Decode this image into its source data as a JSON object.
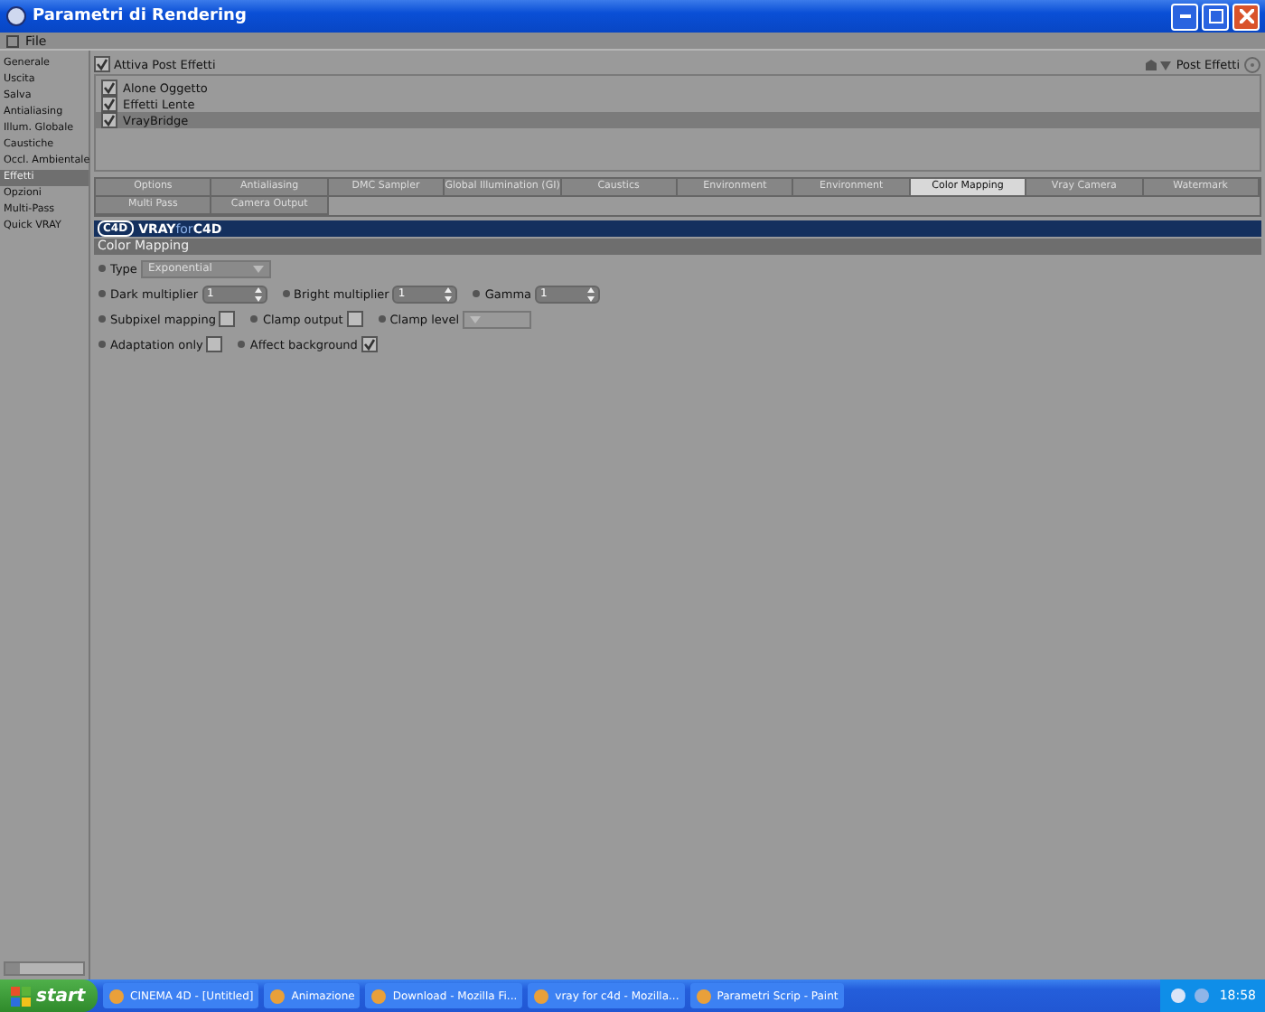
{
  "window": {
    "title": "Parametri di Rendering"
  },
  "menu": [
    "File"
  ],
  "sidebar": {
    "items": [
      {
        "label": "Generale",
        "selected": false
      },
      {
        "label": "Uscita",
        "selected": false
      },
      {
        "label": "Salva",
        "selected": false
      },
      {
        "label": "Antialiasing",
        "selected": false
      },
      {
        "label": "Illum. Globale",
        "selected": false
      },
      {
        "label": "Caustiche",
        "selected": false
      },
      {
        "label": "Occl. Ambientale",
        "selected": false
      },
      {
        "label": "Effetti",
        "selected": true
      },
      {
        "label": "Opzioni",
        "selected": false
      },
      {
        "label": "Multi-Pass",
        "selected": false
      },
      {
        "label": "Quick VRAY",
        "selected": false
      }
    ]
  },
  "effects": {
    "master": {
      "label": "Attiva Post Effetti",
      "checked": true
    },
    "post_effects_label": "Post Effetti",
    "items": [
      {
        "label": "Alone Oggetto",
        "checked": true,
        "selected": false
      },
      {
        "label": "Effetti Lente",
        "checked": true,
        "selected": false
      },
      {
        "label": "VrayBridge",
        "checked": true,
        "selected": true
      }
    ]
  },
  "tabs": [
    {
      "label": "Options",
      "selected": false
    },
    {
      "label": "Antialiasing",
      "selected": false
    },
    {
      "label": "DMC Sampler",
      "selected": false
    },
    {
      "label": "Global Illumination (GI)",
      "selected": false
    },
    {
      "label": "Caustics",
      "selected": false
    },
    {
      "label": "Environment",
      "selected": false
    },
    {
      "label": "Environment",
      "selected": false
    },
    {
      "label": "Color Mapping",
      "selected": true
    },
    {
      "label": "Vray Camera",
      "selected": false
    },
    {
      "label": "Watermark",
      "selected": false
    },
    {
      "label": "Multi Pass",
      "selected": false
    },
    {
      "label": "Camera Output",
      "selected": false
    }
  ],
  "banner": {
    "logo": "C4D",
    "brand": "VRAY",
    "for": "for",
    "product": "C4D"
  },
  "section": {
    "title": "Color Mapping",
    "rows": [
      [
        {
          "kind": "dropdown",
          "label": "Type",
          "value": "Exponential",
          "disabled": false
        }
      ],
      [
        {
          "kind": "number",
          "label": "Dark multiplier",
          "value": "1"
        },
        {
          "kind": "number",
          "label": "Bright multiplier",
          "value": "1"
        },
        {
          "kind": "number",
          "label": "Gamma",
          "value": "1"
        }
      ],
      [
        {
          "kind": "checkbox",
          "label": "Subpixel mapping",
          "checked": false
        },
        {
          "kind": "checkbox",
          "label": "Clamp output",
          "checked": false
        },
        {
          "kind": "dropdown",
          "label": "Clamp level",
          "disabled": true
        }
      ],
      [
        {
          "kind": "checkbox",
          "label": "Adaptation only",
          "checked": false
        },
        {
          "kind": "checkbox",
          "label": "Affect background",
          "checked": true
        }
      ]
    ]
  },
  "taskbar": {
    "start": "start",
    "tasks": [
      {
        "label": "CINEMA 4D - [Untitled]",
        "selected": false
      },
      {
        "label": "Animazione",
        "selected": false
      },
      {
        "label": "Download - Mozilla Fi...",
        "selected": false
      },
      {
        "label": "vray for c4d - Mozilla...",
        "selected": false
      },
      {
        "label": "Parametri Scrip - Paint",
        "selected": false
      }
    ],
    "clock": "18:58"
  }
}
